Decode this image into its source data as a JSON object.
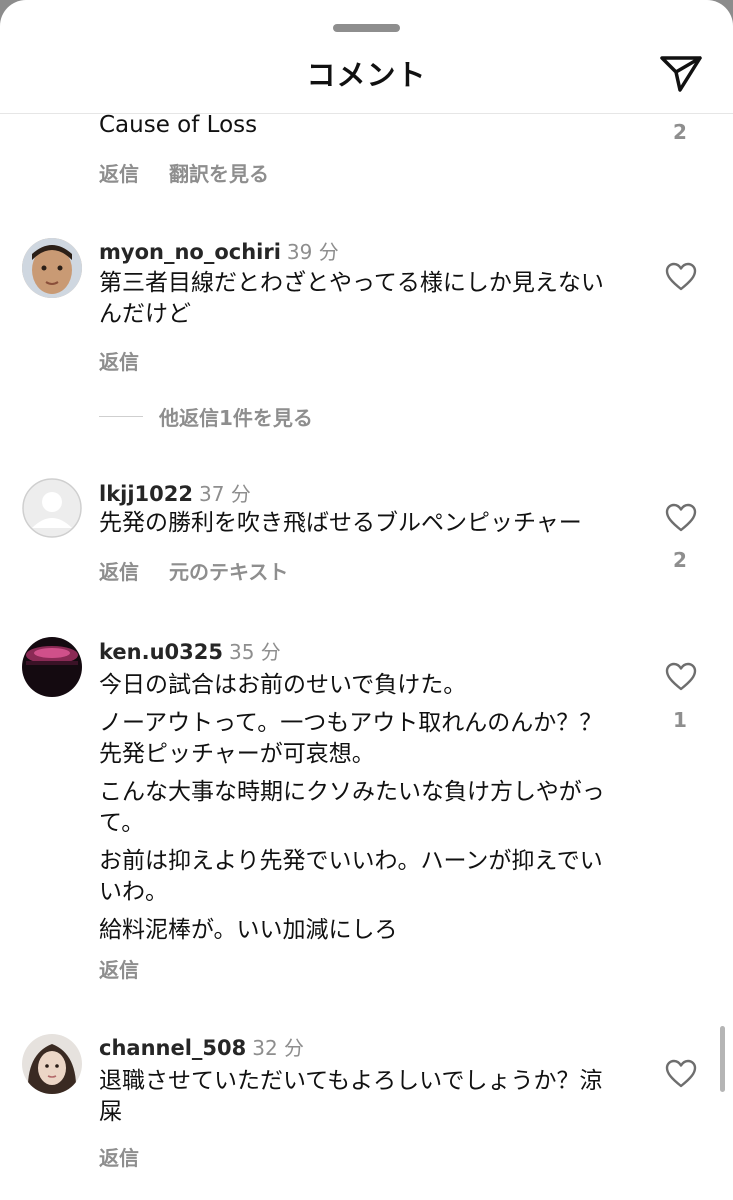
{
  "header": {
    "title": "コメント",
    "send_icon": "send-icon"
  },
  "comments": [
    {
      "text_lines": [
        "Cause of Loss"
      ],
      "actions": [
        "返信",
        "翻訳を見る"
      ],
      "likes": "2"
    },
    {
      "username": "myon_no_ochiri",
      "time": "39 分",
      "text_lines": [
        "第三者目線だとわざとやってる様にしか見えないんだけど"
      ],
      "actions": [
        "返信"
      ],
      "likes": "",
      "view_replies": "他返信1件を見る"
    },
    {
      "username": "lkjj1022",
      "time": "37 分",
      "text_lines": [
        "先発の勝利を吹き飛ばせるブルペンピッチャー"
      ],
      "actions": [
        "返信",
        "元のテキスト"
      ],
      "likes": "2"
    },
    {
      "username": "ken.u0325",
      "time": "35 分",
      "text_lines": [
        "今日の試合はお前のせいで負けた。",
        "ノーアウトって。一つもアウト取れんのんか？？先発ピッチャーが可哀想。",
        "こんな大事な時期にクソみたいな負け方しやがって。",
        "お前は抑えより先発でいいわ。ハーンが抑えでいいわ。",
        "給料泥棒が。いい加減にしろ"
      ],
      "actions": [
        "返信"
      ],
      "likes": "1"
    },
    {
      "username": "channel_508",
      "time": "32 分",
      "text_lines": [
        "退職させていただいてもよろしいでしょうか？涼屎"
      ],
      "actions": [
        "返信"
      ],
      "likes": ""
    }
  ],
  "icons": {
    "heart": "heart-outline-icon",
    "default_avatar": "default-avatar-icon"
  }
}
